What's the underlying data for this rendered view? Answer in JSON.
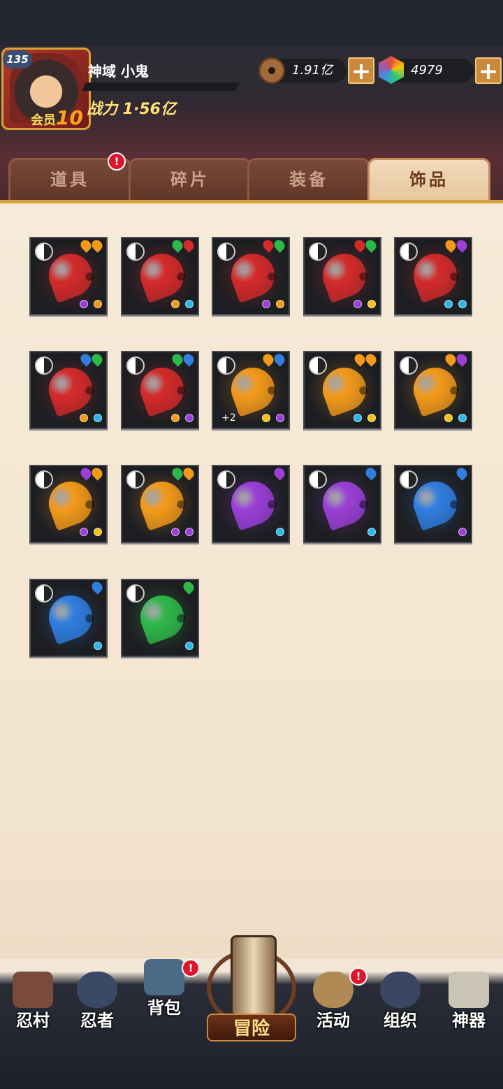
{
  "player": {
    "level": "135",
    "name": "神域 小鬼",
    "vip_label": "会员",
    "vip_level": "10",
    "power": "战力 1·56亿"
  },
  "resources": {
    "coins": "1.91亿",
    "gems": "4979"
  },
  "tabs": [
    {
      "label": "道具",
      "badge": "!"
    },
    {
      "label": "碎片"
    },
    {
      "label": "装备"
    },
    {
      "label": "饰品",
      "active": true
    }
  ],
  "items": [
    {
      "gem": "red",
      "flames": [
        "orange",
        "orange"
      ],
      "dots": [
        "purple",
        "orange"
      ]
    },
    {
      "gem": "red",
      "flames": [
        "green",
        "red"
      ],
      "dots": [
        "orange",
        "cyan"
      ]
    },
    {
      "gem": "red",
      "flames": [
        "red",
        "green"
      ],
      "dots": [
        "purple",
        "orange"
      ]
    },
    {
      "gem": "red",
      "flames": [
        "red",
        "green"
      ],
      "dots": [
        "purple",
        "yellow"
      ]
    },
    {
      "gem": "red",
      "flames": [
        "orange",
        "purple"
      ],
      "dots": [
        "cyan",
        "cyan"
      ]
    },
    {
      "gem": "red",
      "flames": [
        "blue",
        "green"
      ],
      "dots": [
        "orange",
        "cyan"
      ]
    },
    {
      "gem": "red",
      "flames": [
        "green",
        "blue"
      ],
      "dots": [
        "orange",
        "purple"
      ]
    },
    {
      "gem": "orange",
      "flames": [
        "orange",
        "blue"
      ],
      "dots": [
        "yellow",
        "purple"
      ],
      "plus": "+2"
    },
    {
      "gem": "orange",
      "flames": [
        "orange",
        "orange"
      ],
      "dots": [
        "cyan",
        "yellow"
      ]
    },
    {
      "gem": "orange",
      "flames": [
        "orange",
        "purple"
      ],
      "dots": [
        "yellow",
        "cyan"
      ]
    },
    {
      "gem": "orange",
      "flames": [
        "purple",
        "orange"
      ],
      "dots": [
        "purple",
        "yellow"
      ]
    },
    {
      "gem": "orange",
      "flames": [
        "green",
        "orange"
      ],
      "dots": [
        "purple",
        "purple"
      ]
    },
    {
      "gem": "purple",
      "flames": [
        "purple"
      ],
      "dots": [
        "cyan"
      ]
    },
    {
      "gem": "purple",
      "flames": [
        "blue"
      ],
      "dots": [
        "cyan"
      ]
    },
    {
      "gem": "blue",
      "flames": [
        "blue"
      ],
      "dots": [
        "purple"
      ]
    },
    {
      "gem": "blue",
      "flames": [
        "blue"
      ],
      "dots": [
        "cyan"
      ]
    },
    {
      "gem": "green",
      "flames": [
        "green"
      ],
      "dots": [
        "cyan"
      ]
    }
  ],
  "colors": {
    "red": "#d42a2a",
    "orange": "#f39a1a",
    "purple": "#9b3fd8",
    "blue": "#2f7ee0",
    "green": "#2fb84a",
    "yellow": "#f2c21a",
    "cyan": "#2fb6e8"
  },
  "nav": [
    {
      "label": "忍村"
    },
    {
      "label": "忍者"
    },
    {
      "label": "背包",
      "badge": "!"
    },
    {
      "label": "冒险",
      "center": true
    },
    {
      "label": "活动",
      "badge": "!"
    },
    {
      "label": "组织"
    },
    {
      "label": "神器"
    }
  ]
}
